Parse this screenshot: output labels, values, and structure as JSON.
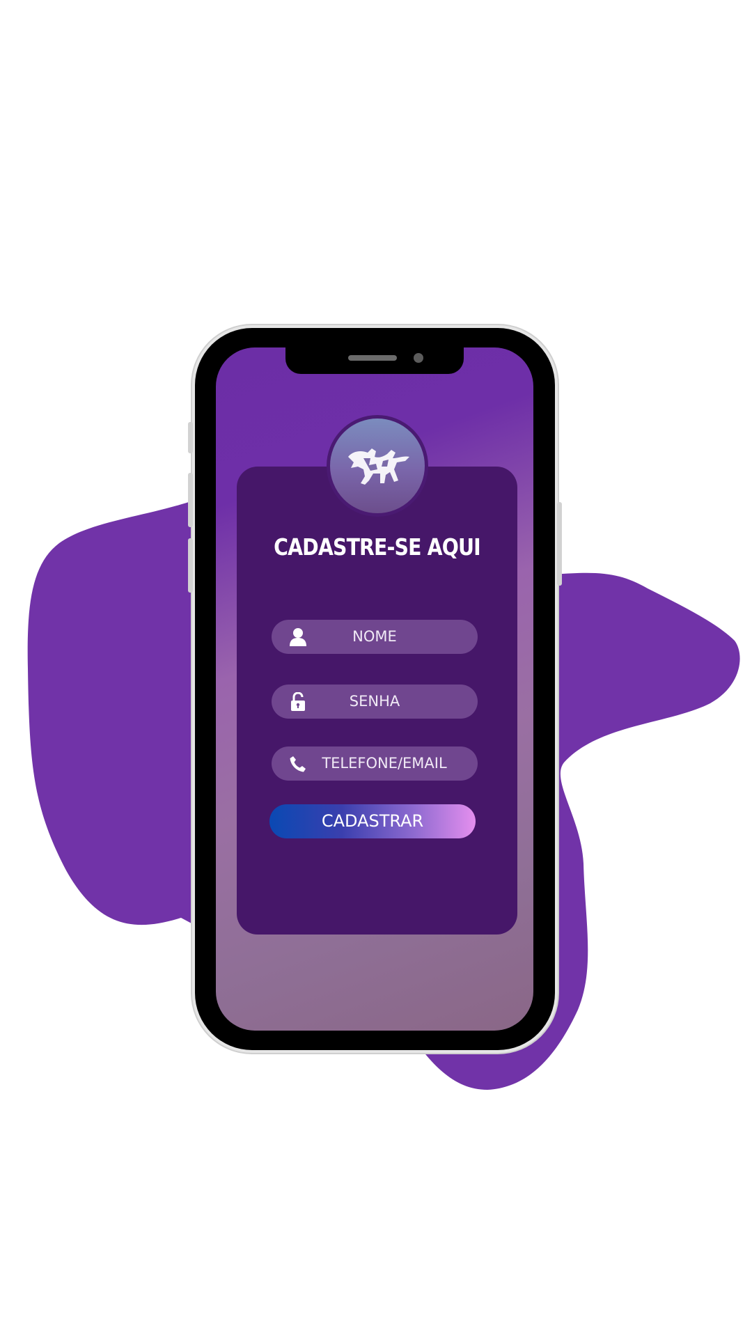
{
  "colors": {
    "blob": "#7133a8",
    "card": "#461769",
    "field": "#70468f",
    "button_start": "#0a49b3",
    "button_end": "#e48fee"
  },
  "form": {
    "title": "CADASTRE-SE AQUI",
    "fields": [
      {
        "icon": "user-icon",
        "label": "NOME"
      },
      {
        "icon": "unlock-icon",
        "label": "SENHA"
      },
      {
        "icon": "phone-icon",
        "label": "TELEFONE/EMAIL"
      }
    ],
    "submit_label": "CADASTRAR"
  },
  "logo": {
    "icon": "bull-rider-logo"
  }
}
